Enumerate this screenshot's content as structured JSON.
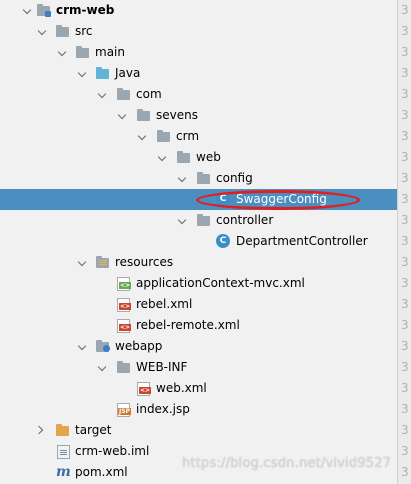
{
  "tree": {
    "items": [
      {
        "label": "crm-web",
        "arrow": "down",
        "icon": "module-folder-icon",
        "bold": true
      },
      {
        "label": "src",
        "arrow": "down",
        "icon": "folder-icon"
      },
      {
        "label": "main",
        "arrow": "down",
        "icon": "folder-icon"
      },
      {
        "label": "Java",
        "arrow": "down",
        "icon": "source-root-folder-icon"
      },
      {
        "label": "com",
        "arrow": "down",
        "icon": "package-icon"
      },
      {
        "label": "sevens",
        "arrow": "down",
        "icon": "package-icon"
      },
      {
        "label": "crm",
        "arrow": "down",
        "icon": "package-icon"
      },
      {
        "label": "web",
        "arrow": "down",
        "icon": "package-icon"
      },
      {
        "label": "config",
        "arrow": "down",
        "icon": "package-icon"
      },
      {
        "label": "SwaggerConfig",
        "arrow": "none",
        "icon": "java-class-icon",
        "selected": true
      },
      {
        "label": "controller",
        "arrow": "down",
        "icon": "package-icon"
      },
      {
        "label": "DepartmentController",
        "arrow": "none",
        "icon": "java-class-icon"
      },
      {
        "label": "resources",
        "arrow": "down",
        "icon": "resources-folder-icon"
      },
      {
        "label": "applicationContext-mvc.xml",
        "arrow": "none",
        "icon": "spring-xml-icon"
      },
      {
        "label": "rebel.xml",
        "arrow": "none",
        "icon": "xml-file-icon"
      },
      {
        "label": "rebel-remote.xml",
        "arrow": "none",
        "icon": "xml-file-icon"
      },
      {
        "label": "webapp",
        "arrow": "down",
        "icon": "web-folder-icon"
      },
      {
        "label": "WEB-INF",
        "arrow": "down",
        "icon": "folder-icon"
      },
      {
        "label": "web.xml",
        "arrow": "none",
        "icon": "xml-file-icon"
      },
      {
        "label": "index.jsp",
        "arrow": "none",
        "icon": "jsp-file-icon"
      },
      {
        "label": "target",
        "arrow": "right",
        "icon": "excluded-folder-icon"
      },
      {
        "label": "crm-web.iml",
        "arrow": "none",
        "icon": "iml-file-icon"
      },
      {
        "label": "pom.xml",
        "arrow": "none",
        "icon": "maven-icon"
      }
    ]
  },
  "icon_text": {
    "class": "C",
    "xml": "<>",
    "jsp": "JSP",
    "maven": "m"
  },
  "gutter": [
    "3",
    "3",
    "3",
    "3",
    "3",
    "3",
    "3",
    "3",
    "3",
    "3",
    "3",
    "3",
    "3",
    "3",
    "3",
    "3",
    "3",
    "3",
    "3",
    "3",
    "3",
    "3",
    "3"
  ],
  "watermark": "https://blog.csdn.net/vivid9527",
  "colors": {
    "selection": "#4a8fbf",
    "annotation_oval": "#e02020"
  }
}
